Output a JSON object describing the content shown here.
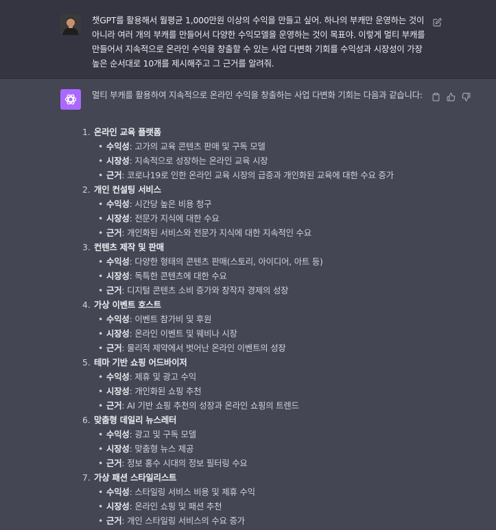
{
  "user_message": {
    "text": "챗GPT를 활용해서 월평균 1,000만원 이상의 수익을 만들고 싶어. 하나의 부캐만 운영하는 것이 아니라 여러 개의 부캐를 만들어서 다양한 수익모델을 운영하는 것이 목표야. 이렇게 멀티 부캐를 만들어서 지속적으로 온라인 수익을 창출할 수 있는 사업 다변화 기회를 수익성과 시장성이 가장 높은 순서대로 10개를 제시해주고 그 근거를 알려줘."
  },
  "assistant_message": {
    "intro": "멀티 부캐를 활용하여 지속적으로 온라인 수익을 창출하는 사업 다변화 기회는 다음과 같습니다:",
    "items": [
      {
        "num": "1.",
        "title": "온라인 교육 플랫폼",
        "details": [
          {
            "label": "수익성",
            "text": ": 고가의 교육 콘텐츠 판매 및 구독 모델"
          },
          {
            "label": "시장성",
            "text": ": 지속적으로 성장하는 온라인 교육 시장"
          },
          {
            "label": "근거",
            "text": ": 코로나19로 인한 온라인 교육 시장의 급증과 개인화된 교육에 대한 수요 증가"
          }
        ]
      },
      {
        "num": "2.",
        "title": "개인 컨설팅 서비스",
        "details": [
          {
            "label": "수익성",
            "text": ": 시간당 높은 비용 청구"
          },
          {
            "label": "시장성",
            "text": ": 전문가 지식에 대한 수요"
          },
          {
            "label": "근거",
            "text": ": 개인화된 서비스와 전문가 지식에 대한 지속적인 수요"
          }
        ]
      },
      {
        "num": "3.",
        "title": "컨텐츠 제작 및 판매",
        "details": [
          {
            "label": "수익성",
            "text": ": 다양한 형태의 콘텐츠 판매(스토리, 아이디어, 아트 등)"
          },
          {
            "label": "시장성",
            "text": ": 독특한 콘텐츠에 대한 수요"
          },
          {
            "label": "근거",
            "text": ": 디지털 콘텐츠 소비 증가와 창작자 경제의 성장"
          }
        ]
      },
      {
        "num": "4.",
        "title": "가상 이벤트 호스트",
        "details": [
          {
            "label": "수익성",
            "text": ": 이벤트 참가비 및 후원"
          },
          {
            "label": "시장성",
            "text": ": 온라인 이벤트 및 웨비나 시장"
          },
          {
            "label": "근거",
            "text": ": 물리적 제약에서 벗어난 온라인 이벤트의 성장"
          }
        ]
      },
      {
        "num": "5.",
        "title": "테마 기반 쇼핑 어드바이저",
        "details": [
          {
            "label": "수익성",
            "text": ": 제휴 및 광고 수익"
          },
          {
            "label": "시장성",
            "text": ": 개인화된 쇼핑 추천"
          },
          {
            "label": "근거",
            "text": ": AI 기반 쇼핑 추천의 성장과 온라인 쇼핑의 트렌드"
          }
        ]
      },
      {
        "num": "6.",
        "title": "맞춤형 데일리 뉴스레터",
        "details": [
          {
            "label": "수익성",
            "text": ": 광고 및 구독 모델"
          },
          {
            "label": "시장성",
            "text": ": 맞춤형 뉴스 제공"
          },
          {
            "label": "근거",
            "text": ": 정보 홍수 시대의 정보 필터링 수요"
          }
        ]
      },
      {
        "num": "7.",
        "title": "가상 패션 스타일리스트",
        "details": [
          {
            "label": "수익성",
            "text": ": 스타일링 서비스 비용 및 제휴 수익"
          },
          {
            "label": "시장성",
            "text": ": 온라인 쇼핑 및 패션 추천"
          },
          {
            "label": "근거",
            "text": ": 개인 스타일링 서비스의 수요 증가"
          }
        ]
      }
    ]
  },
  "colors": {
    "user_bg": "#343541",
    "assistant_bg": "#444654",
    "logo_bg": "#ab68ff",
    "text": "#d1d5db"
  },
  "icons": [
    "user-avatar",
    "edit-icon",
    "chatgpt-logo-icon",
    "copy-icon",
    "thumbs-up-icon",
    "thumbs-down-icon"
  ]
}
